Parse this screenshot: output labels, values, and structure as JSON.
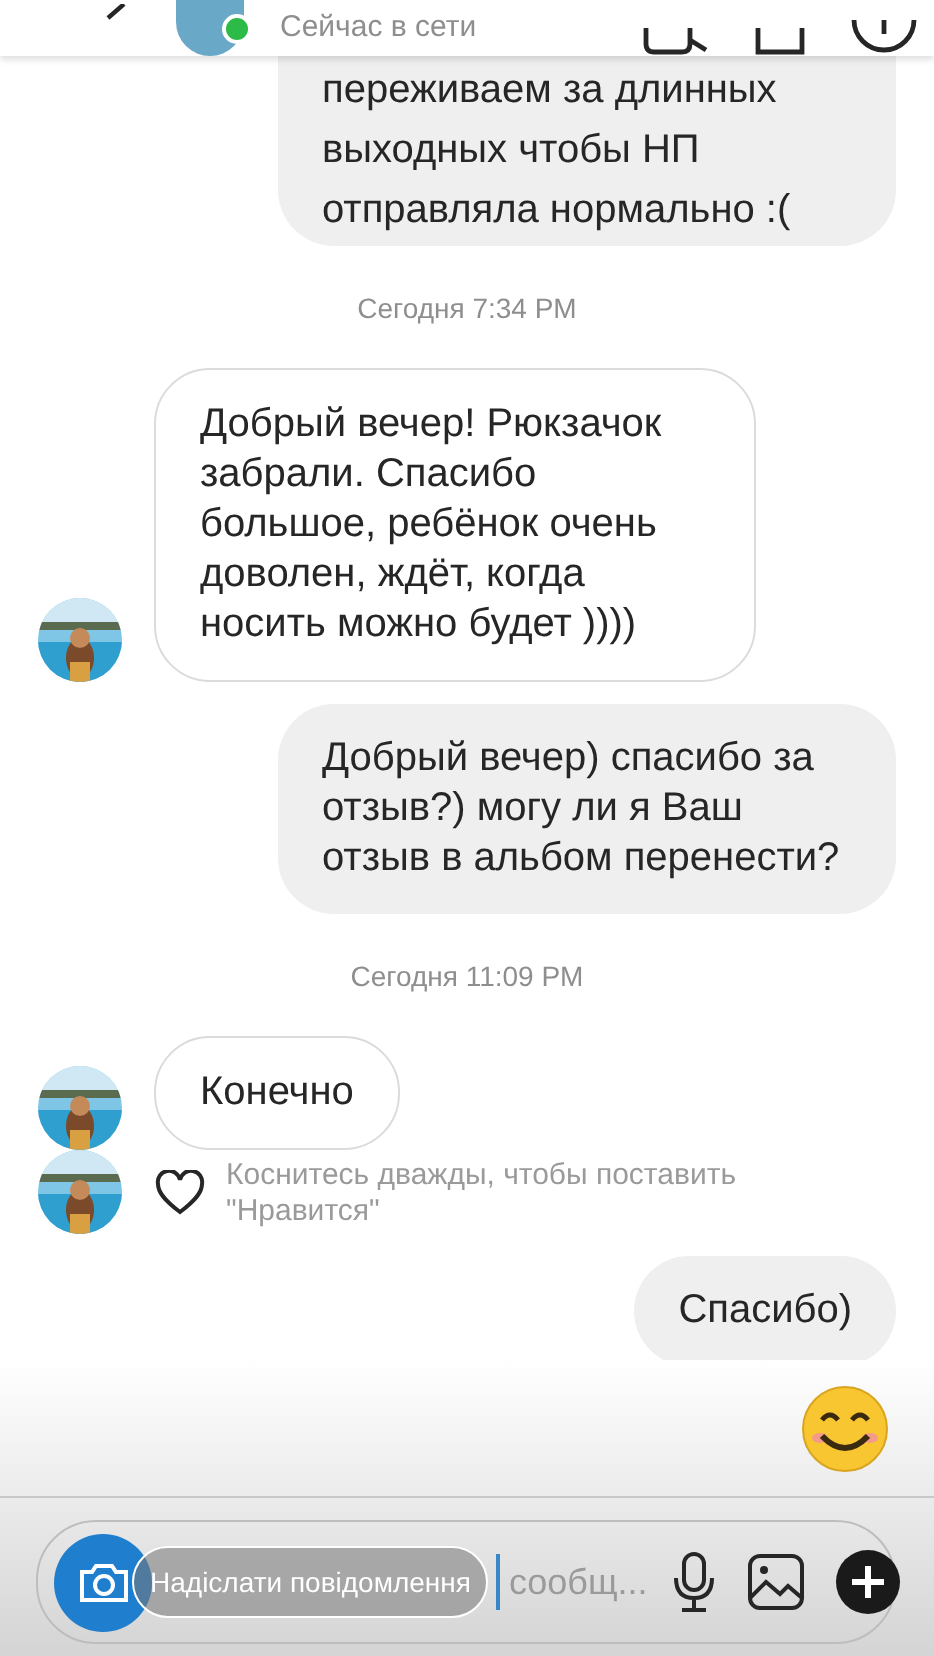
{
  "header": {
    "status": "Сейчас в сети",
    "online": true
  },
  "messages": [
    {
      "kind": "outgoing",
      "text": "переживаем за длинных выходных чтобы НП отправляла нормально :(",
      "cut_top": true
    },
    {
      "kind": "time",
      "text": "Сегодня 7:34 PM"
    },
    {
      "kind": "incoming",
      "text": "Добрый вечер! Рюкзачок забрали. Спасибо большое, ребёнок очень доволен, ждёт, когда носить можно будет ))))"
    },
    {
      "kind": "outgoing",
      "text": "Добрый вечер) спасибо за отзыв?) могу ли я Ваш отзыв в альбом перенести?"
    },
    {
      "kind": "time",
      "text": "Сегодня 11:09 PM"
    },
    {
      "kind": "incoming",
      "text": "Конечно",
      "hint": "Коснитесь дважды, чтобы поставить \"Нравится\""
    },
    {
      "kind": "outgoing",
      "text": "Спасибо)"
    }
  ],
  "composer": {
    "overlay_label": "Надіслати повідомлення",
    "placeholder": "сообщ..."
  }
}
